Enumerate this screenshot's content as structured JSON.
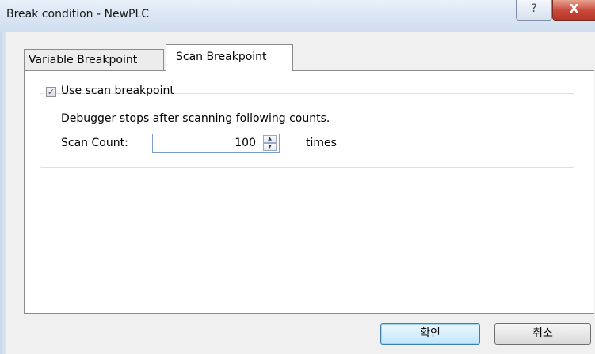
{
  "window": {
    "title": "Break condition - NewPLC",
    "help_glyph": "?",
    "close_glyph": "X"
  },
  "tabs": [
    {
      "label": "Variable Breakpoint",
      "active": false
    },
    {
      "label": "Scan Breakpoint",
      "active": true
    }
  ],
  "scan_breakpoint": {
    "use_checkbox": {
      "label": "Use scan breakpoint",
      "checked": true,
      "check_glyph": "✓"
    },
    "description": "Debugger stops after scanning following counts.",
    "scan_count_label": "Scan Count:",
    "scan_count_value": "100",
    "spin_up_glyph": "▲",
    "spin_down_glyph": "▼",
    "unit_label": "times"
  },
  "buttons": {
    "ok": "확인",
    "cancel": "취소"
  },
  "icons": {
    "help": "help-icon",
    "close": "close-icon",
    "spin_up": "spin-up-icon",
    "spin_down": "spin-down-icon",
    "checkmark": "checkmark-icon"
  }
}
